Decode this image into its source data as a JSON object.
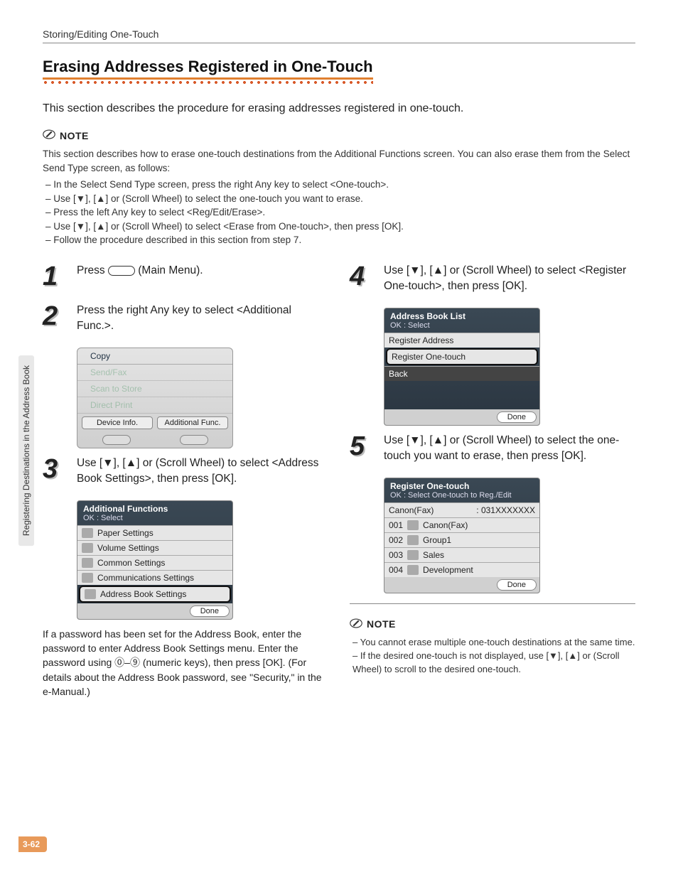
{
  "running_header": "Storing/Editing One-Touch",
  "title": "Erasing Addresses Registered in One-Touch",
  "intro": "This section describes the procedure for erasing addresses registered in one-touch.",
  "note_label": "NOTE",
  "note_intro": "This section describes how to erase one-touch destinations from the Additional Functions screen. You can also erase them from the Select Send Type screen, as follows:",
  "note_items": [
    "In the Select Send Type screen, press the right Any key to select <One-touch>.",
    "Use [▼], [▲] or (Scroll Wheel) to select the one-touch you want to erase.",
    "Press the left Any key to select <Reg/Edit/Erase>.",
    "Use [▼], [▲] or (Scroll Wheel) to select <Erase from One-touch>, then press [OK].",
    "Follow the procedure described in this section from step 7."
  ],
  "steps": {
    "s1": {
      "num": "1",
      "text_a": "Press ",
      "text_b": " (Main Menu)."
    },
    "s2": {
      "num": "2",
      "text": "Press the right Any key to select <Additional Func.>."
    },
    "s3": {
      "num": "3",
      "text": "Use [▼], [▲] or (Scroll Wheel) to select <Address Book Settings>, then press [OK]."
    },
    "s4": {
      "num": "4",
      "text": "Use [▼], [▲] or (Scroll Wheel) to select <Register One-touch>, then press [OK]."
    },
    "s5": {
      "num": "5",
      "text": "Use [▼], [▲] or (Scroll Wheel) to select the one-touch you want to erase, then press [OK]."
    }
  },
  "screen_main": {
    "items": [
      "Copy",
      "Send/Fax",
      "Scan to Store",
      "Direct Print"
    ],
    "buttons": [
      "Device Info.",
      "Additional Func."
    ]
  },
  "screen_addfunc": {
    "title": "Additional Functions",
    "sub": "OK : Select",
    "items": [
      "Paper Settings",
      "Volume Settings",
      "Common Settings",
      "Communications Settings",
      "Address Book Settings"
    ],
    "done": "Done"
  },
  "screen_ablist": {
    "title": "Address Book List",
    "sub": "OK : Select",
    "items": [
      "Register Address",
      "Register One-touch",
      "Back"
    ],
    "done": "Done"
  },
  "screen_reg": {
    "title": "Register One-touch",
    "sub": "OK : Select One-touch to Reg./Edit",
    "header_left": "Canon(Fax)",
    "header_right": ": 031XXXXXXX",
    "rows": [
      {
        "id": "001",
        "name": "Canon(Fax)"
      },
      {
        "id": "002",
        "name": "Group1"
      },
      {
        "id": "003",
        "name": "Sales"
      },
      {
        "id": "004",
        "name": "Development"
      }
    ],
    "done": "Done"
  },
  "after_step3": "If a password has been set for the Address Book, enter the password to enter Address Book Settings menu. Enter the password using ⓪–⑨ (numeric keys), then press [OK]. (For details about the Address Book password, see \"Security,\" in the e-Manual.)",
  "bottom_note": {
    "label": "NOTE",
    "items": [
      "You cannot erase multiple one-touch destinations at the same time.",
      "If the desired one-touch is not displayed, use [▼], [▲] or (Scroll Wheel) to scroll to the desired one-touch."
    ]
  },
  "side_tab": "Registering Destinations in the Address Book",
  "page_number": "3-62"
}
